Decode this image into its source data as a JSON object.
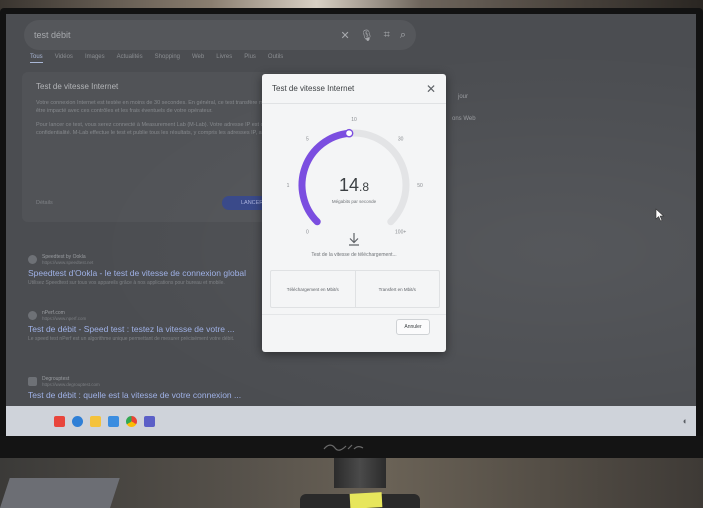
{
  "search": {
    "query": "test débit",
    "tabs": [
      "Tous",
      "Vidéos",
      "Images",
      "Actualités",
      "Shopping",
      "Web",
      "Livres",
      "Plus",
      "Outils"
    ]
  },
  "speed_card": {
    "title": "Test de vitesse Internet",
    "paragraph1": "Votre connexion Internet est testée en moins de 30 secondes. En général, ce test transfère moins de 40 Mo de données. Sachez, cependant, que votre prix peut être impacté avec ces contrôles et les frais éventuels de votre opérateur.",
    "paragraph2": "Pour lancer ce test, vous serez connecté à Measurement Lab (M-Lab). Votre adresse IP est communiquée à ce service et traitée conformément à ses règles de confidentialité. M-Lab effectue le test et publie tous les résultats, y compris les adresses IP, afin de faire progresser la recherche sur Internet.",
    "link": "Détails",
    "button": "LANCER LE TEST"
  },
  "side": {
    "line1": "jour",
    "line2": "ons Web"
  },
  "results": [
    {
      "site": "Speedtest by Ookla",
      "url": "https://www.speedtest.net",
      "title": "Speedtest d'Ookla - le test de vitesse de connexion global",
      "desc": "Utilisez Speedtest sur tous vos appareils grâce à nos applications pour bureau et mobile."
    },
    {
      "site": "nPerf.com",
      "url": "https://www.nperf.com",
      "title": "Test de débit - Speed test : testez la vitesse de votre ...",
      "desc": "Le speed test nPerf est un algorithme unique permettant de mesurer précisément votre débit."
    },
    {
      "site": "Degrouptest",
      "url": "https://www.degrouptest.com",
      "title": "Test de débit : quelle est la vitesse de votre connexion ...",
      "desc": ""
    }
  ],
  "dialog": {
    "title": "Test de vitesse Internet",
    "close_glyph": "✕",
    "speed_int": "14",
    "speed_dec": ".8",
    "unit": "Mégabits par seconde",
    "status": "Test de la vitesse de téléchargement...",
    "download_label": "Téléchargement en Mbit/s",
    "upload_label": "Transfert en Mbit/s",
    "cancel": "Annuler",
    "gauge": {
      "ticks": [
        "0",
        "1",
        "5",
        "10",
        "30",
        "50",
        "100+"
      ],
      "progress_fraction": 0.48,
      "accent": "#7b4ee0",
      "track": "#e3e4e6"
    }
  },
  "taskbar": {
    "icons": [
      "office-icon",
      "edge-icon",
      "explorer-icon",
      "store-icon",
      "chrome-icon",
      "teams-icon"
    ],
    "tray": "◐"
  }
}
